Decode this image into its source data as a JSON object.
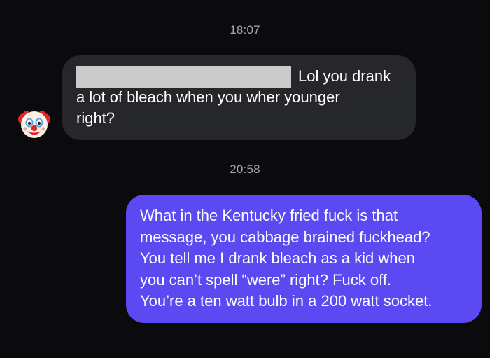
{
  "thread": {
    "timestamp_1": "18:07",
    "timestamp_2": "20:58"
  },
  "incoming_message": {
    "sender_avatar_icon": "clown-face-icon",
    "redacted": true,
    "lines": [
      "Lol you drank",
      "a lot of bleach when you wher younger",
      "right?"
    ],
    "bubble_color": "#26272b"
  },
  "outgoing_message": {
    "lines": [
      "What in the Kentucky fried fuck is that",
      "message, you cabbage brained fuckhead?",
      "You tell me I drank bleach as a kid when",
      "you can’t spell “were” right? Fuck off.",
      "You’re a ten watt bulb in a 200 watt socket."
    ],
    "bubble_color": "#5b49f1"
  },
  "colors": {
    "background": "#0b0b0d",
    "timestamp_text": "#a7a8ac",
    "message_text": "#ffffff"
  }
}
